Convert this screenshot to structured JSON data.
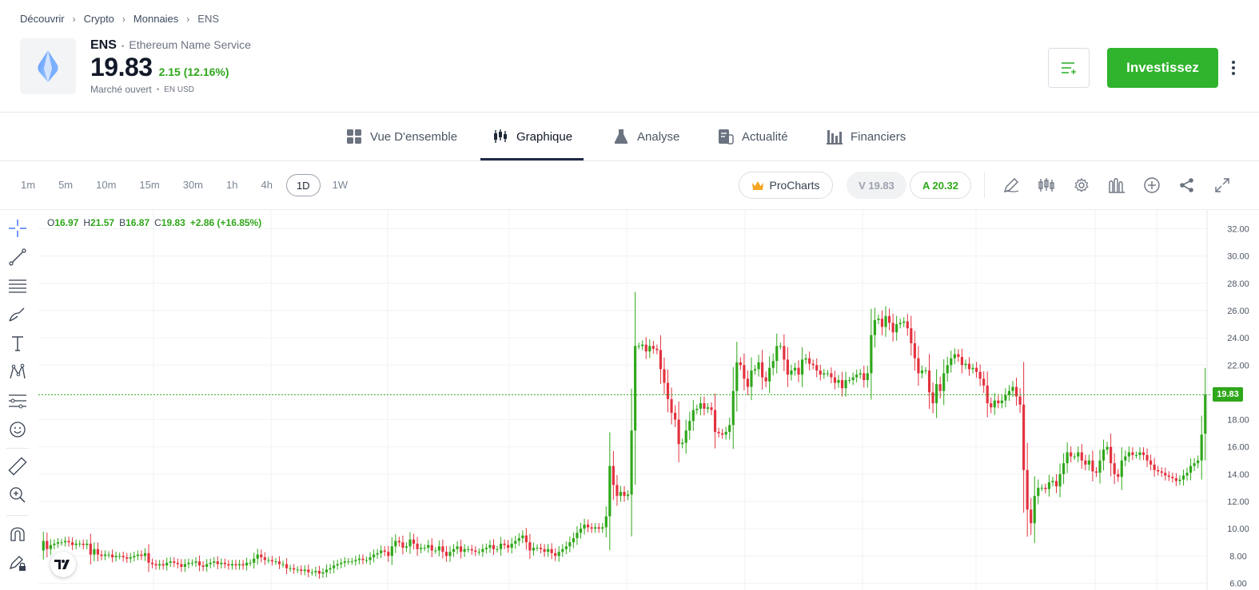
{
  "breadcrumb": [
    "Découvrir",
    "Crypto",
    "Monnaies",
    "ENS"
  ],
  "asset": {
    "symbol": "ENS",
    "name": "Ethereum Name Service",
    "price": "19.83",
    "change": "2.15 (12.16%)",
    "market_status": "Marché ouvert",
    "currency": "EN USD"
  },
  "header_actions": {
    "invest_label": "Investissez",
    "watchlist_icon": "add-to-watchlist-icon",
    "more_icon": "more-vertical-icon"
  },
  "tabs": [
    {
      "label": "Vue D'ensemble",
      "icon": "grid-icon"
    },
    {
      "label": "Graphique",
      "icon": "candles-icon",
      "active": true
    },
    {
      "label": "Analyse",
      "icon": "flask-icon"
    },
    {
      "label": "Actualité",
      "icon": "news-icon"
    },
    {
      "label": "Financiers",
      "icon": "bars-icon"
    }
  ],
  "intervals": [
    "1m",
    "5m",
    "10m",
    "15m",
    "30m",
    "1h",
    "4h",
    "1D",
    "1W"
  ],
  "active_interval": "1D",
  "toolbar": {
    "procharts_label": "ProCharts",
    "sell_label": "V 19.83",
    "buy_label": "A 20.32"
  },
  "ohlc": {
    "o_label": "O",
    "o": "16.97",
    "h_label": "H",
    "h": "21.57",
    "b_label": "B",
    "b": "16.87",
    "c_label": "C",
    "c": "19.83",
    "change": "+2.86 (+16.85%)"
  },
  "colors": {
    "up": "#2fa71a",
    "down": "#e3323f",
    "accent": "#30b32d"
  },
  "chart_data": {
    "type": "candlestick",
    "y_ticks": [
      "32.00",
      "30.00",
      "28.00",
      "26.00",
      "24.00",
      "22.00",
      "19.83",
      "18.00",
      "16.00",
      "14.00",
      "12.00",
      "10.00",
      "8.00",
      "6.00"
    ],
    "ylim": [
      5.5,
      32.5
    ],
    "last_price": 19.83,
    "grid": true,
    "x": [
      1,
      2,
      3,
      4,
      5,
      6,
      7,
      8,
      9,
      10,
      11,
      12,
      13,
      14,
      15,
      16,
      17,
      18,
      19,
      20,
      21,
      22,
      23,
      24,
      25,
      26,
      27,
      28,
      29,
      30,
      31,
      32,
      33,
      34,
      35,
      36,
      37,
      38,
      39,
      40,
      41,
      42,
      43,
      44,
      45,
      46,
      47,
      48,
      49,
      50,
      51,
      52,
      53,
      54,
      55,
      56,
      57,
      58,
      59,
      60,
      61,
      62,
      63,
      64,
      65,
      66,
      67,
      68,
      69,
      70,
      71,
      72,
      73,
      74,
      75,
      76,
      77,
      78,
      79,
      80,
      81,
      82,
      83,
      84,
      85,
      86,
      87,
      88,
      89,
      90,
      91,
      92,
      93,
      94,
      95,
      96,
      97,
      98,
      99,
      100,
      101,
      102,
      103,
      104,
      105,
      106,
      107,
      108,
      109,
      110,
      111,
      112,
      113,
      114,
      115,
      116,
      117,
      118,
      119,
      120,
      121,
      122,
      123,
      124,
      125,
      126,
      127,
      128,
      129,
      130,
      131,
      132,
      133,
      134,
      135,
      136,
      137,
      138,
      139,
      140,
      141,
      142,
      143,
      144,
      145,
      146,
      147,
      148,
      149,
      150,
      151,
      152,
      153,
      154,
      155,
      156,
      157,
      158,
      159,
      160,
      161,
      162,
      163,
      164,
      165,
      166,
      167,
      168,
      169,
      170,
      171,
      172,
      173,
      174,
      175,
      176,
      177,
      178,
      179,
      180,
      181,
      182,
      183,
      184,
      185,
      186,
      187,
      188,
      189,
      190,
      191,
      192,
      193,
      194,
      195,
      196,
      197,
      198,
      199,
      200,
      201,
      202,
      203,
      204,
      205,
      206,
      207,
      208,
      209,
      210,
      211,
      212,
      213,
      214,
      215,
      216,
      217,
      218,
      219,
      220,
      221,
      222,
      223,
      224,
      225,
      226,
      227,
      228,
      229,
      230,
      231,
      232,
      233,
      234,
      235,
      236,
      237,
      238,
      239,
      240,
      241,
      242,
      243,
      244,
      245,
      246,
      247,
      248,
      249,
      250,
      251,
      252,
      253,
      254,
      255,
      256,
      257,
      258,
      259,
      260,
      261,
      262,
      263,
      264,
      265,
      266,
      267,
      268,
      269,
      270,
      271,
      272,
      273,
      274,
      275,
      276,
      277,
      278,
      279,
      280,
      281,
      282,
      283,
      284,
      285,
      286,
      287,
      288,
      289,
      290,
      291,
      292,
      293,
      294,
      295,
      296,
      297,
      298,
      299,
      300,
      301,
      302,
      303,
      304,
      305,
      306,
      307,
      308,
      309,
      310,
      311,
      312,
      313,
      314,
      315,
      316,
      317,
      318,
      319,
      320,
      321,
      322,
      323,
      324,
      325,
      326,
      327,
      328,
      329,
      330,
      331,
      332,
      333,
      334,
      335,
      336,
      337,
      338,
      339,
      340,
      341,
      342,
      343,
      344,
      345,
      346,
      347,
      348,
      349,
      350,
      351,
      352,
      353,
      354,
      355,
      356,
      357,
      358,
      359,
      360,
      361,
      362,
      363,
      364,
      365,
      366,
      367,
      368,
      369,
      370,
      371,
      372,
      373,
      374,
      375,
      376,
      377,
      378,
      379,
      380
    ],
    "close": [
      9.1,
      8.5,
      8.8,
      8.9,
      9.0,
      9.0,
      9.1,
      9.0,
      8.8,
      8.9,
      8.9,
      8.8,
      8.9,
      8.1,
      8.5,
      8.1,
      8.0,
      8.1,
      8.1,
      7.9,
      8.0,
      8.0,
      7.9,
      7.8,
      7.9,
      8.0,
      8.1,
      8.0,
      8.2,
      7.5,
      7.4,
      7.3,
      7.4,
      7.3,
      7.5,
      7.6,
      7.5,
      7.4,
      7.2,
      7.4,
      7.5,
      7.5,
      7.6,
      7.3,
      7.2,
      7.4,
      7.5,
      7.6,
      7.4,
      7.5,
      7.4,
      7.3,
      7.4,
      7.3,
      7.4,
      7.3,
      7.5,
      7.5,
      7.8,
      8.1,
      7.9,
      7.7,
      7.7,
      7.6,
      7.6,
      7.4,
      7.4,
      7.1,
      7.1,
      7.0,
      7.0,
      6.9,
      7.0,
      6.8,
      6.8,
      6.9,
      6.7,
      6.8,
      7.0,
      7.1,
      7.3,
      7.4,
      7.5,
      7.6,
      7.6,
      7.6,
      7.7,
      7.8,
      7.7,
      7.7,
      7.9,
      8.1,
      8.2,
      8.4,
      8.3,
      8.0,
      8.7,
      9.1,
      9.0,
      8.6,
      8.7,
      9.2,
      8.9,
      8.5,
      8.6,
      8.6,
      8.8,
      8.4,
      8.4,
      8.7,
      8.3,
      8.0,
      8.3,
      8.5,
      8.7,
      8.3,
      8.5,
      8.5,
      8.4,
      8.3,
      8.3,
      8.5,
      8.6,
      8.8,
      8.5,
      8.5,
      8.9,
      8.8,
      8.6,
      8.9,
      9.1,
      9.3,
      9.5,
      9.0,
      8.4,
      8.6,
      8.6,
      8.5,
      8.3,
      8.5,
      8.2,
      8.0,
      8.3,
      8.5,
      8.7,
      9.0,
      9.3,
      9.7,
      10.0,
      10.3,
      10.1,
      10.0,
      10.1,
      10.0,
      10.1,
      10.9,
      14.6,
      13.2,
      12.4,
      12.7,
      12.4,
      12.5,
      17.2,
      23.4,
      23.4,
      23.5,
      23.0,
      23.4,
      23.2,
      23.1,
      21.7,
      20.7,
      19.5,
      18.5,
      18.0,
      16.2,
      16.3,
      17.2,
      17.9,
      18.7,
      18.8,
      19.2,
      18.8,
      18.9,
      18.7,
      17.1,
      17.0,
      16.9,
      17.1,
      17.6,
      20.1,
      22.2,
      22.0,
      21.0,
      20.4,
      21.6,
      21.7,
      22.2,
      21.1,
      20.8,
      21.8,
      22.3,
      23.4,
      23.4,
      22.4,
      21.3,
      21.6,
      21.8,
      21.3,
      22.4,
      22.5,
      22.1,
      22.0,
      21.6,
      21.3,
      21.4,
      21.4,
      21.1,
      20.7,
      20.9,
      20.3,
      20.9,
      20.9,
      21.1,
      21.3,
      21.4,
      20.9,
      21.4,
      24.2,
      25.3,
      25.4,
      24.8,
      25.6,
      25.1,
      24.4,
      25.0,
      25.1,
      25.2,
      24.7,
      23.6,
      22.5,
      21.4,
      21.6,
      21.6,
      20.0,
      19.2,
      20.6,
      20.1,
      21.4,
      22.0,
      22.5,
      22.8,
      22.6,
      22.0,
      22.1,
      21.7,
      21.8,
      21.5,
      21.0,
      20.5,
      19.2,
      18.9,
      19.4,
      19.2,
      19.4,
      19.8,
      20.1,
      20.4,
      19.7,
      19.1,
      14.3,
      11.4,
      10.4,
      12.4,
      13.0,
      13.0,
      12.9,
      13.4,
      13.5,
      13.1,
      14.0,
      14.8,
      15.6,
      15.3,
      15.3,
      15.6,
      15.0,
      14.7,
      15.0,
      14.2,
      14.1,
      15.0,
      15.8,
      16.0,
      14.8,
      14.0,
      13.8,
      15.0,
      15.3,
      15.6,
      15.4,
      15.4,
      15.6,
      15.4,
      15.0,
      14.7,
      14.3,
      14.2,
      14.1,
      13.9,
      13.8,
      13.7,
      13.5,
      13.6,
      13.9,
      14.1,
      14.6,
      14.8,
      15.0,
      16.9,
      19.83
    ],
    "open": [
      8.4,
      9.1,
      8.5,
      8.8,
      8.9,
      9.0,
      9.0,
      9.1,
      9.0,
      8.8,
      8.9,
      8.9,
      8.8,
      8.9,
      8.1,
      8.5,
      8.1,
      8.0,
      8.1,
      8.1,
      7.9,
      8.0,
      8.0,
      7.9,
      7.8,
      7.9,
      8.0,
      8.1,
      8.0,
      8.2,
      7.5,
      7.4,
      7.3,
      7.4,
      7.3,
      7.5,
      7.6,
      7.5,
      7.4,
      7.2,
      7.4,
      7.5,
      7.5,
      7.6,
      7.3,
      7.2,
      7.4,
      7.5,
      7.6,
      7.4,
      7.5,
      7.4,
      7.3,
      7.4,
      7.3,
      7.4,
      7.3,
      7.5,
      7.5,
      7.8,
      8.1,
      7.9,
      7.7,
      7.7,
      7.6,
      7.6,
      7.4,
      7.4,
      7.1,
      7.1,
      7.0,
      7.0,
      6.9,
      7.0,
      6.8,
      6.8,
      6.9,
      6.7,
      6.8,
      7.0,
      7.1,
      7.3,
      7.4,
      7.5,
      7.6,
      7.6,
      7.6,
      7.7,
      7.8,
      7.7,
      7.7,
      7.9,
      8.1,
      8.2,
      8.4,
      8.3,
      8.0,
      8.7,
      9.1,
      9.0,
      8.6,
      8.7,
      9.2,
      8.9,
      8.5,
      8.6,
      8.6,
      8.8,
      8.4,
      8.4,
      8.7,
      8.3,
      8.0,
      8.3,
      8.5,
      8.7,
      8.3,
      8.5,
      8.5,
      8.4,
      8.3,
      8.3,
      8.5,
      8.6,
      8.8,
      8.5,
      8.5,
      8.9,
      8.8,
      8.6,
      8.9,
      9.1,
      9.3,
      9.5,
      9.0,
      8.4,
      8.6,
      8.6,
      8.5,
      8.3,
      8.5,
      8.2,
      8.0,
      8.3,
      8.5,
      8.7,
      9.0,
      9.3,
      9.7,
      10.0,
      10.3,
      10.1,
      10.0,
      10.1,
      10.0,
      10.1,
      10.9,
      14.6,
      13.2,
      12.4,
      12.7,
      12.4,
      12.5,
      17.2,
      23.4,
      23.4,
      23.5,
      23.0,
      23.4,
      23.2,
      23.1,
      21.7,
      20.7,
      19.5,
      18.5,
      18.0,
      16.2,
      16.3,
      17.2,
      17.9,
      18.7,
      18.8,
      19.2,
      18.8,
      18.9,
      18.7,
      17.1,
      17.0,
      16.9,
      17.1,
      17.6,
      20.1,
      22.2,
      22.0,
      21.0,
      20.4,
      21.6,
      21.7,
      22.2,
      21.1,
      20.8,
      21.8,
      22.3,
      23.4,
      23.4,
      22.4,
      21.3,
      21.6,
      21.8,
      21.3,
      22.4,
      22.5,
      22.1,
      22.0,
      21.6,
      21.3,
      21.4,
      21.4,
      21.1,
      20.7,
      20.9,
      20.3,
      20.9,
      20.9,
      21.1,
      21.3,
      21.4,
      20.9,
      21.4,
      24.2,
      25.3,
      25.4,
      24.8,
      25.6,
      25.1,
      24.4,
      25.0,
      25.1,
      25.2,
      24.7,
      23.6,
      22.5,
      21.4,
      21.6,
      21.6,
      20.0,
      19.2,
      20.6,
      20.1,
      21.4,
      22.0,
      22.5,
      22.8,
      22.6,
      22.0,
      22.1,
      21.7,
      21.8,
      21.5,
      21.0,
      20.5,
      19.2,
      18.9,
      19.4,
      19.2,
      19.4,
      19.8,
      20.1,
      20.4,
      19.7,
      19.1,
      14.3,
      11.4,
      10.4,
      12.4,
      13.0,
      13.0,
      12.9,
      13.4,
      13.5,
      13.1,
      14.0,
      14.8,
      15.6,
      15.3,
      15.3,
      15.6,
      15.0,
      14.7,
      15.0,
      14.2,
      14.1,
      15.0,
      15.8,
      16.0,
      14.8,
      14.0,
      13.8,
      15.0,
      15.3,
      15.6,
      15.4,
      15.4,
      15.6,
      15.4,
      15.0,
      14.7,
      14.3,
      14.2,
      14.1,
      13.9,
      13.8,
      13.7,
      13.5,
      13.6,
      13.9,
      14.1,
      14.6,
      14.8,
      15.0,
      16.97
    ]
  }
}
